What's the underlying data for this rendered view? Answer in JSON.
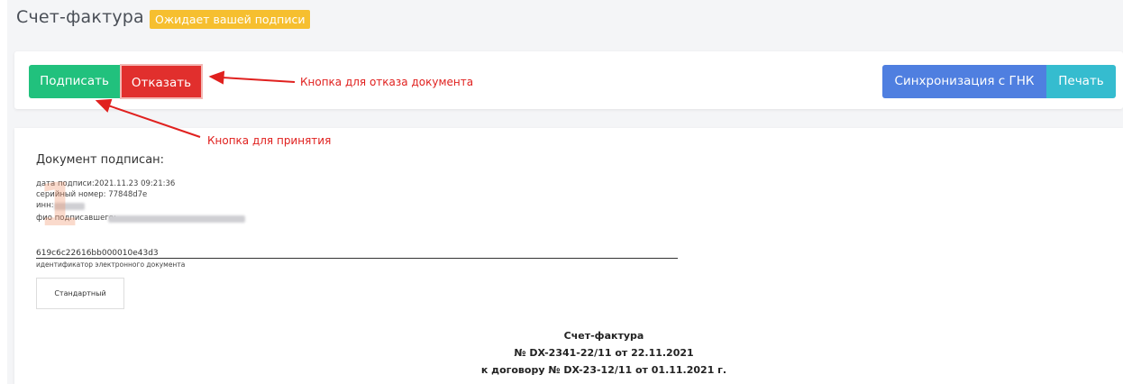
{
  "header": {
    "title": "Счет-фактура",
    "status_badge": "Ожидает вашей подписи"
  },
  "toolbar": {
    "sign_label": "Подписать",
    "reject_label": "Отказать",
    "sync_label": "Синхронизация с ГНК",
    "print_label": "Печать"
  },
  "annotations": {
    "reject_hint": "Кнопка для отказа документа",
    "accept_hint": "Кнопка для принятия"
  },
  "signature": {
    "heading": "Документ подписан:",
    "date_label": "дата подписи:",
    "date_value": "2021.11.23 09:21:36",
    "serial_label": "серийный номер:",
    "serial_value": "77848d7e",
    "inn_label": "инн:",
    "signer_label": "фио подписавшего:",
    "step_number": "1"
  },
  "document": {
    "id": "619c6c22616bb000010e43d3",
    "id_caption": "идентификатор электронного документа",
    "format_label": "Стандартный"
  },
  "invoice": {
    "title": "Счет-фактура",
    "number_line": "№ DX-2341-22/11 от 22.11.2021",
    "contract_line": "к договору № DX-23-12/11 от 01.11.2021 г."
  },
  "colors": {
    "sign": "#21c17d",
    "reject": "#e12f2d",
    "sync": "#4f7fe0",
    "print": "#35bccf",
    "badge": "#f6bf2f",
    "annotation": "#e0211f"
  }
}
